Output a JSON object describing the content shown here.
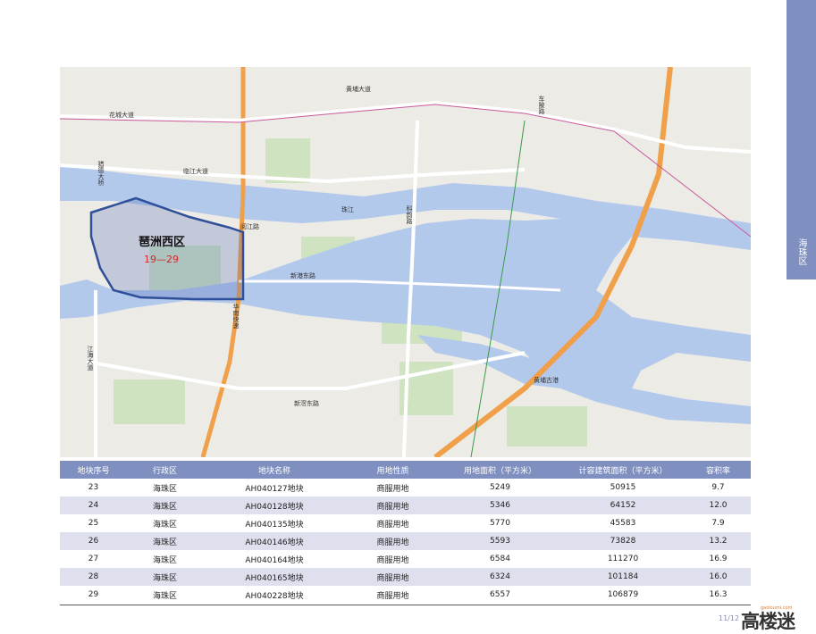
{
  "side_tab": {
    "label": "海珠区",
    "color": "#7f8fbf"
  },
  "map": {
    "district_name": "琶洲西区",
    "plot_range": "19—29",
    "labels": {
      "huacheng_ave": "花城大道",
      "huangpu_ave": "黄埔大道",
      "chepo_road": "车陂路",
      "liejiang_ave": "临江大道",
      "liede_bridge": "猎德大桥",
      "yuejiang_road": "阅江路",
      "kehui_road": "科韵路",
      "xingang_east_road": "新港东路",
      "huanan_expressway": "华南快速",
      "jiangwan_ave": "江海大道",
      "xingang_road": "新滘东路",
      "huangpu_ancient_port": "黄埔古港",
      "zhujiang": "珠江"
    }
  },
  "table": {
    "headers": [
      "地块序号",
      "行政区",
      "地块名称",
      "用地性质",
      "用地面积（平方米）",
      "计容建筑面积（平方米）",
      "容积率"
    ],
    "rows": [
      [
        "23",
        "海珠区",
        "AH040127地块",
        "商服用地",
        "5249",
        "50915",
        "9.7"
      ],
      [
        "24",
        "海珠区",
        "AH040128地块",
        "商服用地",
        "5346",
        "64152",
        "12.0"
      ],
      [
        "25",
        "海珠区",
        "AH040135地块",
        "商服用地",
        "5770",
        "45583",
        "7.9"
      ],
      [
        "26",
        "海珠区",
        "AH040146地块",
        "商服用地",
        "5593",
        "73828",
        "13.2"
      ],
      [
        "27",
        "海珠区",
        "AH040164地块",
        "商服用地",
        "6584",
        "111270",
        "16.9"
      ],
      [
        "28",
        "海珠区",
        "AH040165地块",
        "商服用地",
        "6324",
        "101184",
        "16.0"
      ],
      [
        "29",
        "海珠区",
        "AH040228地块",
        "商服用地",
        "6557",
        "106879",
        "16.3"
      ]
    ]
  },
  "footer": {
    "page_number": "11/12",
    "logo_text": "高楼迷",
    "logo_url": "gaoloumi.com"
  }
}
